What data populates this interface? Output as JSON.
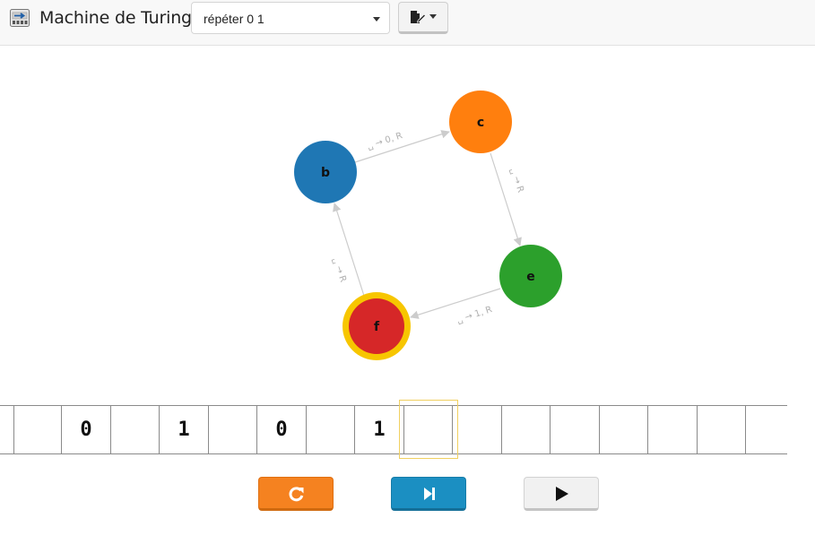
{
  "app": {
    "title": "Machine de Turing",
    "selected_machine": "répéter 0 1"
  },
  "diagram": {
    "states": [
      {
        "name": "b",
        "color": "#1f77b4"
      },
      {
        "name": "c",
        "color": "#ff7f0e"
      },
      {
        "name": "e",
        "color": "#2ca02c"
      },
      {
        "name": "f",
        "color": "#d62728",
        "active": true
      }
    ],
    "transitions": [
      {
        "label": "␣ → 0, R"
      },
      {
        "label": "␣ → R"
      },
      {
        "label": "␣ → 1, R"
      },
      {
        "label": "␣ → R"
      }
    ],
    "active_ring_color": "#f7c600",
    "edge_color": "#cccccc"
  },
  "tape": {
    "cells": [
      "",
      "0",
      "",
      "1",
      "",
      "0",
      "",
      "1",
      "",
      "",
      "",
      "",
      "",
      "",
      "",
      ""
    ],
    "head_color": "#f0d060"
  },
  "controls": {
    "reset_icon": "reset-icon",
    "step_icon": "step-forward-icon",
    "run_icon": "play-icon"
  }
}
